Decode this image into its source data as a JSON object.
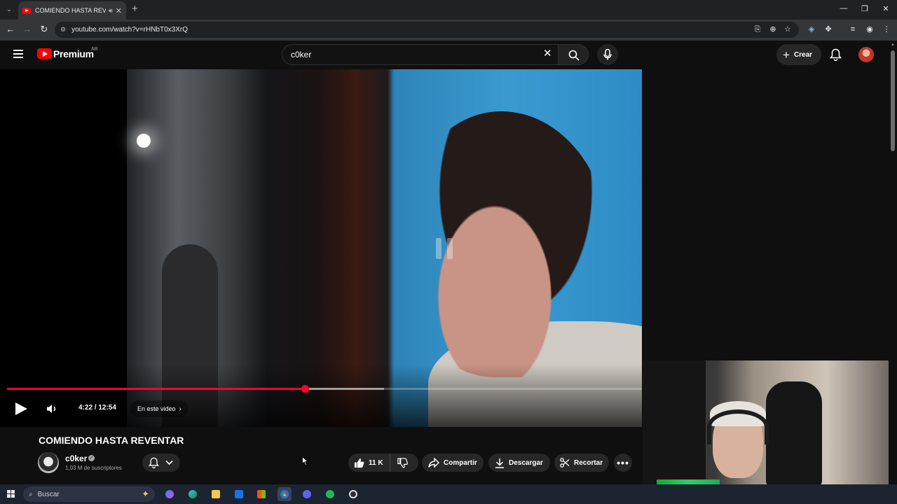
{
  "browser": {
    "tab_title": "COMIENDO HASTA REVENTAR",
    "tab_audio_icon": "speaker-icon",
    "url": "youtube.com/watch?v=rHNbT0x3XrQ",
    "window_controls": [
      "—",
      "❐",
      "✕"
    ]
  },
  "masthead": {
    "brand": "Premium",
    "country": "AR",
    "search_value": "c0ker",
    "create_label": "Crear"
  },
  "player": {
    "current_time": "4:22",
    "duration": "12:54",
    "time_text": "4:22 / 12:54",
    "played_fraction": 0.4687,
    "loaded_fraction": 0.594,
    "in_video_label": "En este video",
    "accent_color": "#ff0033"
  },
  "video": {
    "title": "COMIENDO HASTA REVENTAR",
    "channel_name": "c0ker",
    "subscribers": "1,03 M de suscriptores",
    "likes": "11 K",
    "share_label": "Compartir",
    "download_label": "Descargar",
    "clip_label": "Recortar"
  },
  "taskbar": {
    "search_placeholder": "Buscar",
    "apps": [
      "copilot-icon",
      "edge-icon",
      "file-explorer-icon",
      "outlook-icon",
      "store-icon",
      "chrome-icon",
      "discord-icon",
      "spotify-icon",
      "obs-icon"
    ]
  }
}
